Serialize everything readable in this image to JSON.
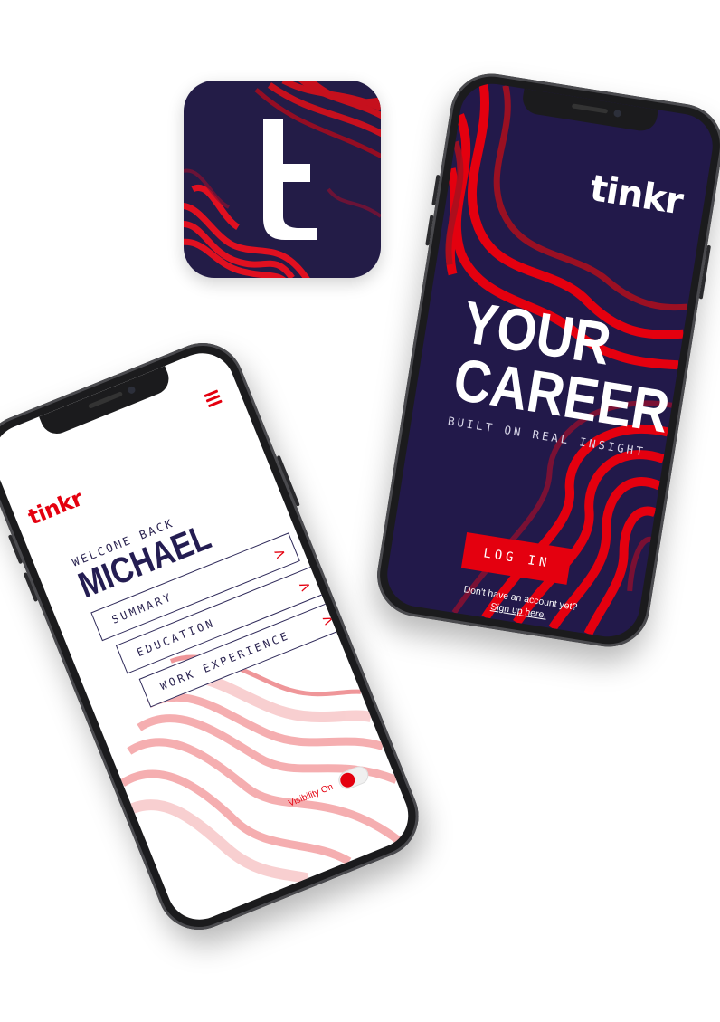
{
  "colors": {
    "brand_red": "#e4000f",
    "brand_navy": "#22194a",
    "text_navy": "#241d52",
    "white": "#ffffff"
  },
  "app_icon": {
    "glyph": "t",
    "icon": "tinkr-app-icon"
  },
  "login_screen": {
    "brand": "tinkr",
    "hero_line_1": "YOUR",
    "hero_line_2": "CAREER",
    "tagline": "BUILT ON REAL INSIGHT",
    "login_label": "LOG IN",
    "signup_prompt": "Don't have an account yet?",
    "signup_link": "Sign up here."
  },
  "profile_screen": {
    "brand": "tinkr",
    "menu_icon": "hamburger-menu-icon",
    "welcome": "WELCOME BACK",
    "user_name": "MICHAEL",
    "nav_items": [
      {
        "label": "SUMMARY",
        "chevron": ">"
      },
      {
        "label": "EDUCATION",
        "chevron": ">"
      },
      {
        "label": "WORK EXPERIENCE",
        "chevron": ">"
      }
    ],
    "visibility_label": "Visibility On",
    "visibility_on": true
  }
}
